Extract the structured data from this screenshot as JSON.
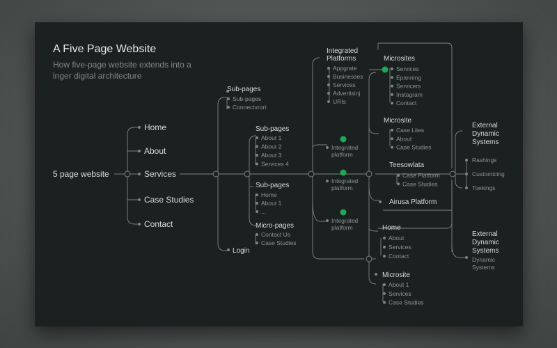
{
  "title": "A Five Page Website",
  "subtitle": "How five-page website extends into a lnger digital architecture",
  "colors": {
    "background": "#1b2120",
    "line": "#7b8784",
    "text": "#d6dcda",
    "muted": "#8b9693",
    "accent": "#1fa855"
  },
  "root": {
    "label": "5 page website"
  },
  "pages": [
    "Home",
    "About",
    "Services",
    "Case Studies",
    "Contact"
  ],
  "tier2": {
    "subpages_a": {
      "label": "Sub-pages",
      "items": [
        "Sub-pages",
        "Connectvrort"
      ]
    },
    "login": {
      "label": "Login"
    }
  },
  "tier3": {
    "subpages_b": {
      "label": "Sub-pages",
      "items": [
        "About 1",
        "About 2",
        "About 3",
        "Services 4"
      ]
    },
    "subpages_c": {
      "label": "Sub-pages",
      "items": [
        "Home",
        "About 1",
        "..."
      ]
    },
    "micropages": {
      "label": "Micro-pages",
      "items": [
        "Contact Us",
        "Case Studies"
      ]
    }
  },
  "tier4": {
    "integrated_platforms": {
      "label_line1": "Integrated",
      "label_line2": "Platforms",
      "items": [
        "Appgrate",
        "Businesses",
        "Services",
        "Advertisinj",
        "URIs"
      ]
    },
    "platform_nodes": [
      {
        "line1": "Integrated",
        "line2": "platform"
      },
      {
        "line1": "Integrated",
        "line2": "platform"
      },
      {
        "line1": "Integrated",
        "line2": "platform"
      }
    ]
  },
  "tier5": {
    "microsites": {
      "label": "Microsites",
      "items": [
        "Services",
        "Epanning",
        "Servicers",
        "Instagram",
        "Contact"
      ]
    },
    "microsite_a": {
      "label": "Microsite",
      "items": [
        "Case Lites",
        "About",
        "Case Studies"
      ]
    },
    "teesowlata": {
      "label": "Teesowlata",
      "items": [
        "Case Platform",
        "Case Studies"
      ]
    },
    "airusa": {
      "label": "Airusa Platform"
    },
    "home": {
      "label": "Home",
      "items": [
        "About",
        "Services",
        "Contact"
      ]
    },
    "microsite_b": {
      "label": "Microsite",
      "items": [
        "About 1",
        "Services",
        "Case Studies"
      ]
    }
  },
  "external": [
    {
      "line1": "External",
      "line2": "Dynamic",
      "line3": "Systems",
      "items": [
        "Rashings",
        "Customicing",
        "Toekings"
      ]
    },
    {
      "line1": "External",
      "line2": "Dynamic",
      "line3": "Systems",
      "items": [
        "Dynamic",
        "Systems"
      ]
    }
  ]
}
